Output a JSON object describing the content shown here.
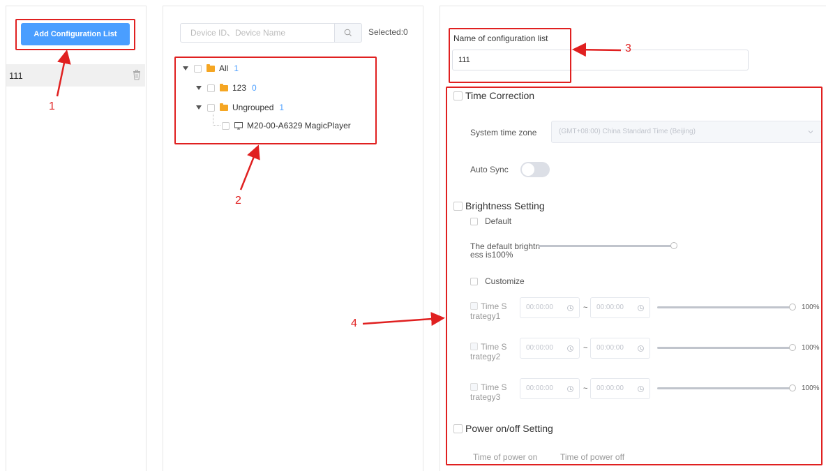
{
  "left_panel": {
    "add_button_label": "Add Configuration List",
    "config_items": [
      {
        "name": "111"
      }
    ]
  },
  "middle_panel": {
    "search_placeholder": "Device ID、Device Name",
    "selected_label": "Selected:0",
    "tree": {
      "all": {
        "label": "All",
        "count": "1"
      },
      "group_123": {
        "label": "123",
        "count": "0"
      },
      "ungrouped": {
        "label": "Ungrouped",
        "count": "1"
      },
      "device": {
        "label": "M20-00-A6329 MagicPlayer"
      }
    }
  },
  "right_panel": {
    "config_name_label": "Name of configuration list",
    "config_name_value": "111",
    "time_correction": {
      "title": "Time Correction",
      "timezone_label": "System time zone",
      "timezone_value": "(GMT+08:00) China Standard Time (Beijing)",
      "auto_sync_label": "Auto Sync",
      "auto_sync_on": false
    },
    "brightness": {
      "title": "Brightness Setting",
      "default_label": "Default",
      "default_text_line1": "The default brightn",
      "default_text_line2": "ess is100%",
      "default_level": 1.0,
      "customize_label": "Customize",
      "strategies": [
        {
          "line1": "Time S",
          "line2": "trategy1",
          "start": "00:00:00",
          "end": "00:00:00",
          "percent": "100%",
          "level": 1.0
        },
        {
          "line1": "Time S",
          "line2": "trategy2",
          "start": "00:00:00",
          "end": "00:00:00",
          "percent": "100%",
          "level": 1.0
        },
        {
          "line1": "Time S",
          "line2": "trategy3",
          "start": "00:00:00",
          "end": "00:00:00",
          "percent": "100%",
          "level": 1.0
        }
      ],
      "tilde": "~"
    },
    "power": {
      "title": "Power on/off Setting",
      "on_label": "Time of power on",
      "off_label": "Time of power off"
    }
  },
  "annotations": [
    "1",
    "2",
    "3",
    "4"
  ],
  "colors": {
    "accent": "#4a9eff",
    "annotation": "#e02020",
    "folder": "#f5a623"
  }
}
